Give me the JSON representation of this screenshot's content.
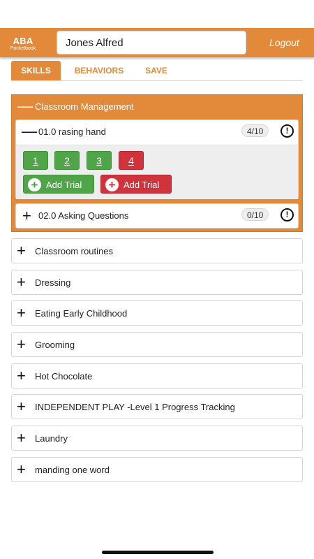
{
  "header": {
    "logo_line1": "ABA",
    "logo_line2": "Pocketbook",
    "client_name": "Jones Alfred",
    "logout_label": "Logout"
  },
  "tabs": [
    {
      "label": "SKILLS",
      "active": true
    },
    {
      "label": "BEHAVIORS",
      "active": false
    },
    {
      "label": "SAVE",
      "active": false
    }
  ],
  "expanded_category": {
    "title": "Classroom Management",
    "expanded_sign": "—",
    "skills": [
      {
        "title": "01.0 rasing hand",
        "count": "4/10",
        "sign": "—",
        "expanded": true,
        "trials": [
          {
            "label": "1",
            "result": "correct"
          },
          {
            "label": "2",
            "result": "correct"
          },
          {
            "label": "3",
            "result": "correct"
          },
          {
            "label": "4",
            "result": "incorrect"
          }
        ],
        "add_correct_label": "Add Trial",
        "add_incorrect_label": "Add Trial"
      },
      {
        "title": "02.0 Asking Questions",
        "count": "0/10",
        "sign": "+",
        "expanded": false
      }
    ]
  },
  "categories": [
    {
      "label": "Classroom routines"
    },
    {
      "label": "Dressing"
    },
    {
      "label": "Eating Early Childhood"
    },
    {
      "label": "Grooming"
    },
    {
      "label": "Hot Chocolate"
    },
    {
      "label": "INDEPENDENT PLAY -Level 1 Progress Tracking"
    },
    {
      "label": "Laundry"
    },
    {
      "label": "manding one word"
    }
  ],
  "icons": {
    "collapsed": "plus-icon",
    "expanded": "minus-icon",
    "alert": "alert-circle-icon",
    "add": "add-circle-icon"
  },
  "colors": {
    "accent": "#e28a3a",
    "correct": "#4fa548",
    "incorrect": "#d0333b"
  }
}
